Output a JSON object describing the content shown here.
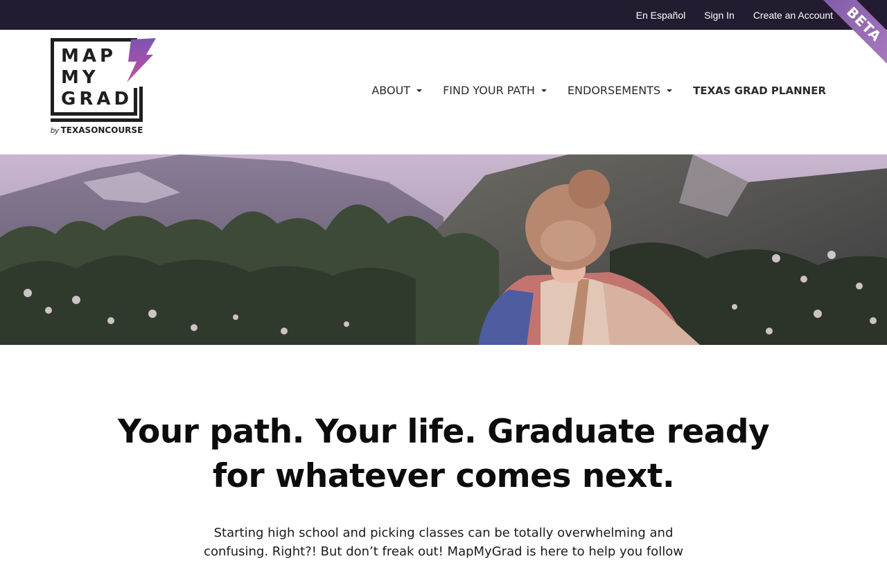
{
  "utility_nav": {
    "espanol": "En Español",
    "sign_in": "Sign In",
    "create_account": "Create an Account"
  },
  "beta_ribbon": "BETA",
  "logo": {
    "line1": "MAP",
    "line2": "MY",
    "line3": "GRAD",
    "byline_by": "by",
    "byline_org": "TEXASONCOURSE"
  },
  "main_nav": [
    {
      "label": "ABOUT",
      "dropdown": true
    },
    {
      "label": "FIND YOUR PATH",
      "dropdown": true
    },
    {
      "label": "ENDORSEMENTS",
      "dropdown": true
    },
    {
      "label": "TEXAS GRAD PLANNER",
      "dropdown": false
    }
  ],
  "hero": {
    "image": "hiker-girl-with-backpack-mountain-valley"
  },
  "intro": {
    "headline": "Your path. Your life. Graduate ready for whatever comes next.",
    "body": "Starting high school and picking classes can be totally overwhelming and confusing. Right?! But don’t freak out! MapMyGrad is here to help you follow"
  },
  "colors": {
    "utility_bar": "#231b30",
    "beta_ribbon": "#9a6bb8",
    "bolt_top": "#7a55b4",
    "bolt_bottom": "#c24fa0"
  }
}
